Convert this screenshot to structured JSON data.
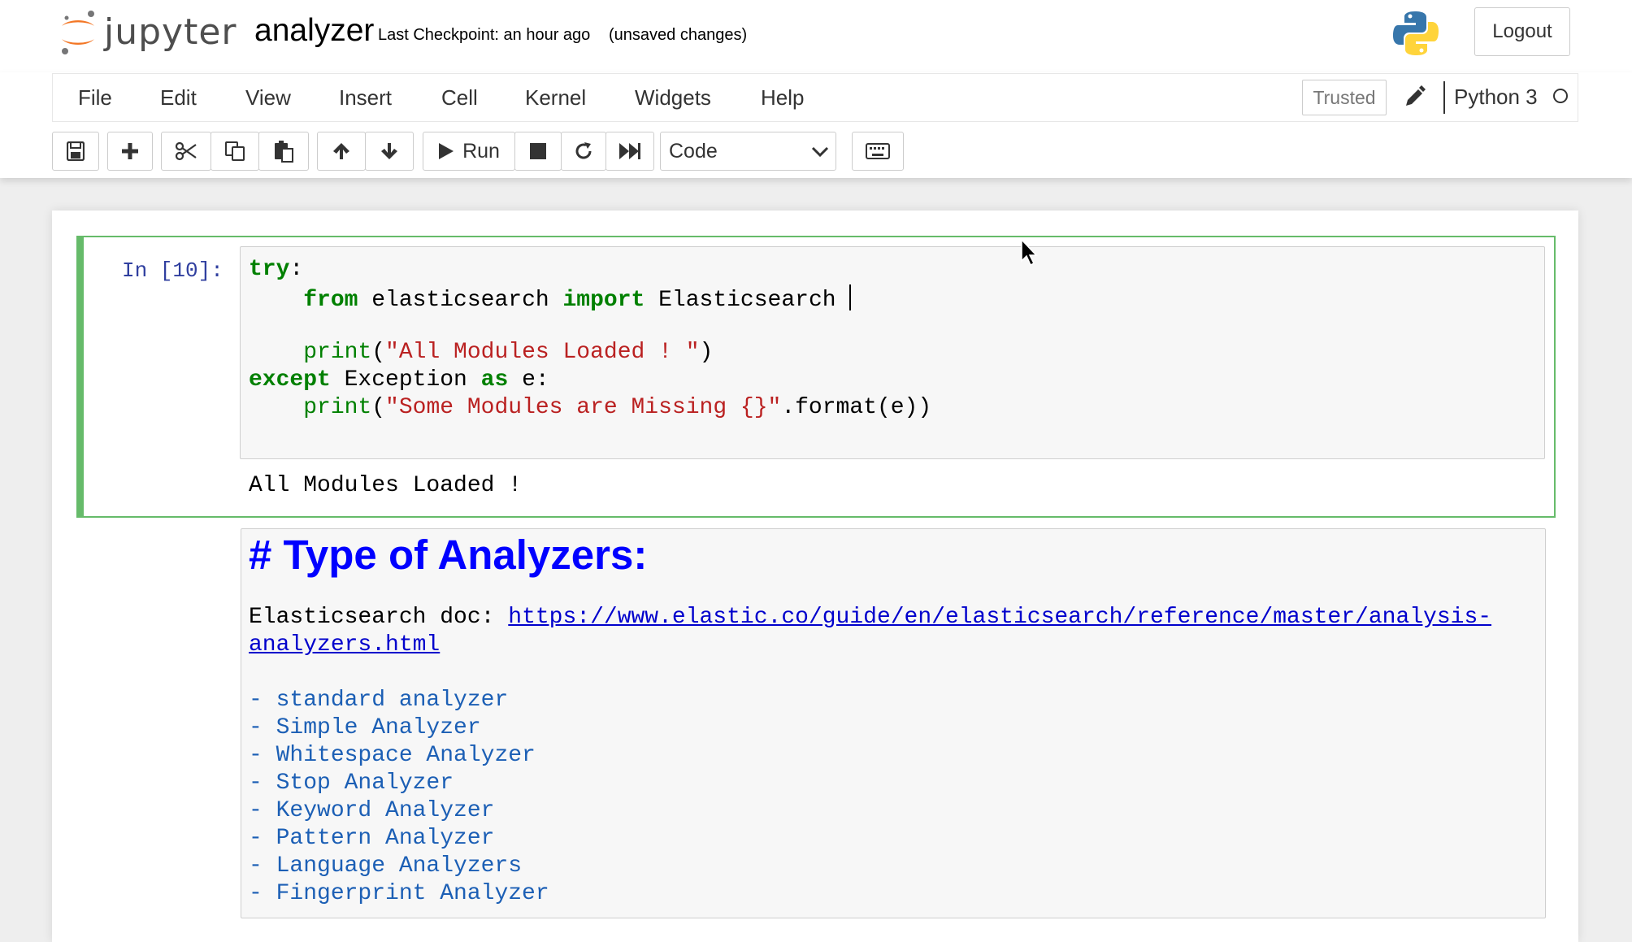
{
  "header": {
    "logo_text": "jupyter",
    "notebook_name": "analyzer",
    "checkpoint": "Last Checkpoint: an hour ago",
    "unsaved": "(unsaved changes)",
    "logout_label": "Logout"
  },
  "menu": {
    "items": [
      "File",
      "Edit",
      "View",
      "Insert",
      "Cell",
      "Kernel",
      "Widgets",
      "Help"
    ],
    "trusted_label": "Trusted",
    "kernel_name": "Python 3"
  },
  "toolbar": {
    "run_label": "Run",
    "cell_type": "Code",
    "icons": [
      "save-icon",
      "plus-icon",
      "cut-icon",
      "copy-icon",
      "paste-icon",
      "arrow-up-icon",
      "arrow-down-icon",
      "run-icon",
      "stop-icon",
      "restart-icon",
      "fast-forward-icon",
      "keyboard-icon"
    ]
  },
  "code_cell": {
    "prompt": "In [10]:",
    "lines": [
      {
        "kw1": "try",
        "rest1": ":"
      },
      {
        "indent": "    ",
        "kw1": "from",
        "mid": " elasticsearch ",
        "kw2": "import",
        "rest": " Elasticsearch "
      },
      {
        "indent": "    ",
        "fn": "print",
        "open": "(",
        "str": "\"All Modules Loaded ! \"",
        "close": ")"
      },
      {
        "kw1": "except",
        "mid": " Exception ",
        "kw2": "as",
        "rest": " e:"
      },
      {
        "indent": "    ",
        "fn": "print",
        "open": "(",
        "str": "\"Some Modules are Missing {}\"",
        "close": ".format(e))"
      }
    ],
    "output": "All Modules Loaded !"
  },
  "markdown_cell": {
    "heading": "# Type of Analyzers:",
    "doc_label": "Elasticsearch doc: ",
    "doc_link_line1": "https://www.elastic.co/guide/en/elasticsearch/reference/master/analysis-",
    "doc_link_line2": "analyzers.html",
    "items": [
      "- standard analyzer",
      "- Simple Analyzer",
      "- Whitespace Analyzer",
      "- Stop Analyzer",
      "- Keyword Analyzer",
      "- Pattern Analyzer",
      "- Language Analyzers",
      "- Fingerprint Analyzer"
    ]
  },
  "colors": {
    "keyword": "#008000",
    "string": "#ba2121",
    "selected_cell_border": "#66bb6a",
    "markdown_heading": "#0000ff",
    "markdown_list": "#1c5fb5",
    "prompt": "#303f9f"
  }
}
